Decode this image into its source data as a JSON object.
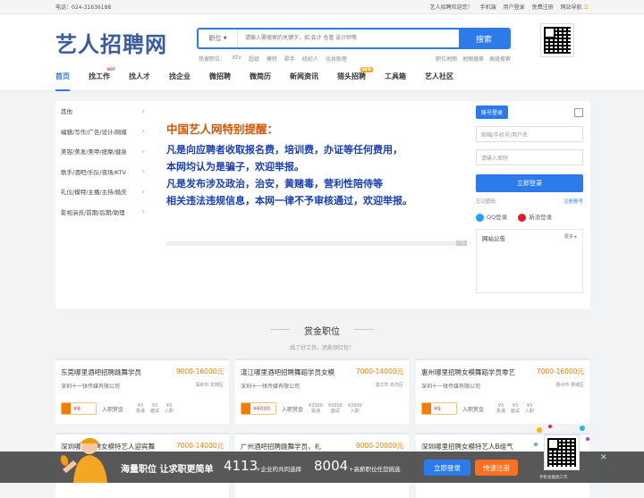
{
  "topbar": {
    "phone": "电话：024-31636188",
    "welcome": "艺人招聘欢迎您！",
    "mobile": "手机端",
    "login": "用户登录",
    "register": "免费注册",
    "sitenav": "网站导航"
  },
  "logo": "艺人招聘网",
  "search": {
    "category": "职位",
    "placeholder": "请输入需搜索的关键字，如 会计 仓管 设计师等",
    "button": "搜索"
  },
  "hot": {
    "label": "热搜职位：",
    "items": [
      "Ktv",
      "超组",
      "模特",
      "歌手",
      "经纪人",
      "化妆助理"
    ]
  },
  "adv": [
    "职位地图",
    "地图搜索",
    "高级搜索"
  ],
  "nav": [
    {
      "label": "首页",
      "active": true
    },
    {
      "label": "找工作",
      "badge": "HOT"
    },
    {
      "label": "找人才"
    },
    {
      "label": "找企业"
    },
    {
      "label": "微招聘"
    },
    {
      "label": "微简历"
    },
    {
      "label": "新闻资讯"
    },
    {
      "label": "猎头招聘",
      "badge": "NEW"
    },
    {
      "label": "工具箱"
    },
    {
      "label": "艺人社区"
    }
  ],
  "categories": [
    "其他",
    "编辑/写作/广告/设计/网媒",
    "美容/美发/美甲/按摩/健身",
    "歌手/酒吧/乐队/夜场/KTV",
    "礼仪/模特/主播/主持/婚庆",
    "影视演员/前期/后期/助理"
  ],
  "banner": {
    "title": "中国艺人网特别提醒：",
    "lines": [
      "凡是向应聘者收取报名费，培训费，办证等任何费用，",
      "本网均认为是骗子，欢迎举报。",
      "凡是发布涉及政治，治安，黄赌毒，营利性陪侍等",
      "相关违法违规信息，本网一律不予审核通过，欢迎举报。"
    ],
    "tag": "广告"
  },
  "login": {
    "tab": "账号登录",
    "user_ph": "邮箱/手机号/用户名",
    "pwd_ph": "请输入密码",
    "button": "立即登录",
    "forgot": "忘记密码",
    "reg": "注册账号",
    "qq": "QQ登录",
    "weibo": "新浪登录",
    "notice": "网站公告",
    "more": "更多"
  },
  "section": {
    "title": "赏金职位",
    "sub": "找了好工作，还能领红包！"
  },
  "cards": [
    {
      "title": "东莞哪里酒吧招聘跳舞学员",
      "salary": "9000-16000元",
      "company": "深圳十一钵传媒有限公司",
      "loc": "深圳市 龙岗区",
      "reward": "¥9",
      "rlabel": "入职赏金",
      "m": [
        [
          "¥3",
          "投递"
        ],
        [
          "¥3",
          "面试"
        ],
        [
          "¥3",
          "入职"
        ]
      ]
    },
    {
      "title": "湛江哪里酒吧招聘舞蹈学员女模",
      "salary": "7000-14000元",
      "company": "深圳十一钵传媒有限公司",
      "loc": "湛江市 赤坎区",
      "reward": "¥6000",
      "rlabel": "入职赏金",
      "m": [
        [
          "¥2000",
          "投递"
        ],
        [
          "¥2000",
          "面试"
        ],
        [
          "¥2000",
          "入职"
        ]
      ]
    },
    {
      "title": "惠州哪里招聘女模舞蹈学员零艺",
      "salary": "7000-16000元",
      "company": "深圳十一钵传媒有限公司",
      "loc": "惠州市 惠城区",
      "reward": "¥9",
      "rlabel": "入职赏金",
      "m": [
        [
          "¥3",
          "投递"
        ],
        [
          "¥3",
          "面试"
        ],
        [
          "¥3",
          "入职"
        ]
      ]
    },
    {
      "title": "深圳哪里招聘女模特艺人迎宾舞",
      "salary": "7000-14000元",
      "company": "",
      "loc": "",
      "reward": "",
      "rlabel": "",
      "m": []
    },
    {
      "title": "广州酒吧招聘跳舞学员，礼",
      "salary": "9000-20000元",
      "company": "",
      "loc": "",
      "reward": "",
      "rlabel": "",
      "m": []
    },
    {
      "title": "深圳哪里招聘女模特艺人B组气",
      "salary": "",
      "company": "",
      "loc": "",
      "reward": "",
      "rlabel": "",
      "m": []
    }
  ],
  "bottom": {
    "msg": "海量职位 让求职更简单",
    "n1": "4113",
    "d1": "+企业的共同选择",
    "n2": "8004",
    "d2": "+高薪职位任您挑选",
    "b1": "立即登录",
    "b2": "快速注册",
    "qr": "手机也能找工作",
    "close": "✕"
  },
  "colors": {
    "primary": "#2d7bea",
    "orange": "#f57c00",
    "banner_text": "#1a3fb3",
    "banner_title": "#d35400"
  }
}
